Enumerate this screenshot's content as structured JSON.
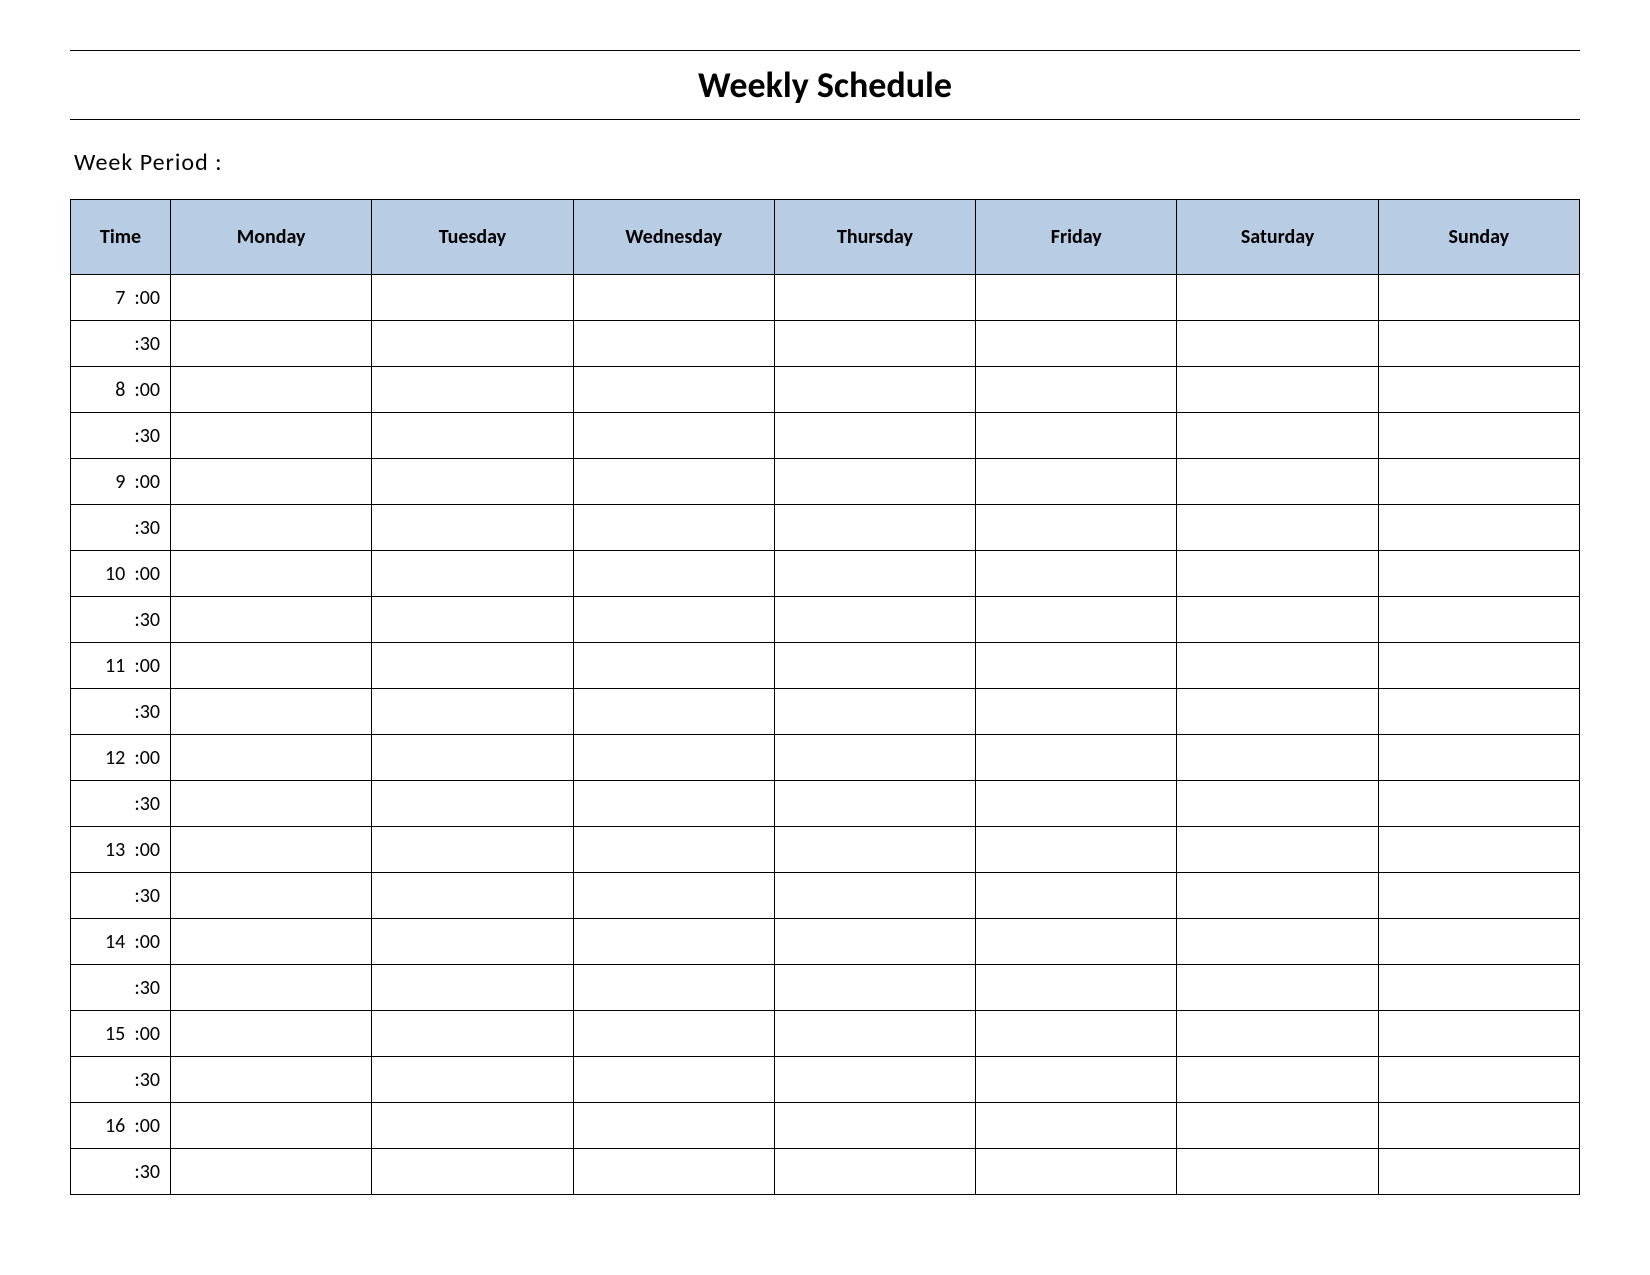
{
  "title": "Weekly Schedule",
  "week_period_label": "Week  Period :",
  "headers": {
    "time": "Time",
    "days": [
      "Monday",
      "Tuesday",
      "Wednesday",
      "Thursday",
      "Friday",
      "Saturday",
      "Sunday"
    ]
  },
  "time_rows": [
    {
      "label": "7  :00",
      "hour": 7,
      "minute": 0
    },
    {
      "label": ":30",
      "hour": 7,
      "minute": 30
    },
    {
      "label": "8  :00",
      "hour": 8,
      "minute": 0
    },
    {
      "label": ":30",
      "hour": 8,
      "minute": 30
    },
    {
      "label": "9  :00",
      "hour": 9,
      "minute": 0
    },
    {
      "label": ":30",
      "hour": 9,
      "minute": 30
    },
    {
      "label": "10  :00",
      "hour": 10,
      "minute": 0
    },
    {
      "label": ":30",
      "hour": 10,
      "minute": 30
    },
    {
      "label": "11  :00",
      "hour": 11,
      "minute": 0
    },
    {
      "label": ":30",
      "hour": 11,
      "minute": 30
    },
    {
      "label": "12  :00",
      "hour": 12,
      "minute": 0
    },
    {
      "label": ":30",
      "hour": 12,
      "minute": 30
    },
    {
      "label": "13  :00",
      "hour": 13,
      "minute": 0
    },
    {
      "label": ":30",
      "hour": 13,
      "minute": 30
    },
    {
      "label": "14  :00",
      "hour": 14,
      "minute": 0
    },
    {
      "label": ":30",
      "hour": 14,
      "minute": 30
    },
    {
      "label": "15  :00",
      "hour": 15,
      "minute": 0
    },
    {
      "label": ":30",
      "hour": 15,
      "minute": 30
    },
    {
      "label": "16  :00",
      "hour": 16,
      "minute": 0
    },
    {
      "label": ":30",
      "hour": 16,
      "minute": 30
    }
  ],
  "colors": {
    "header_bg": "#b8cce4",
    "border": "#000000",
    "dashed": "#777777"
  }
}
